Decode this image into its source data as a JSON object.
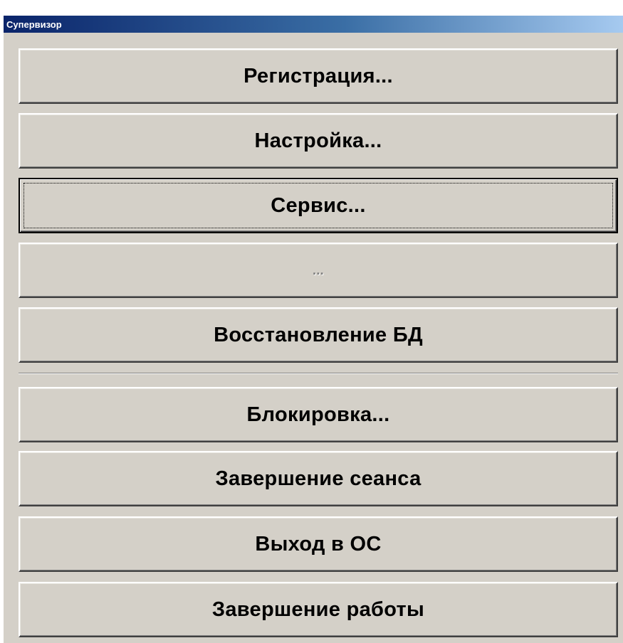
{
  "window": {
    "title": "Супервизор"
  },
  "menu": {
    "registration": "Регистрация...",
    "settings": "Настройка...",
    "service": "Сервис...",
    "disabled_item": "...",
    "db_restore": "Восстановление БД",
    "lock": "Блокировка...",
    "end_session": "Завершение сеанса",
    "exit_to_os": "Выход в ОС",
    "shutdown": "Завершение работы"
  }
}
